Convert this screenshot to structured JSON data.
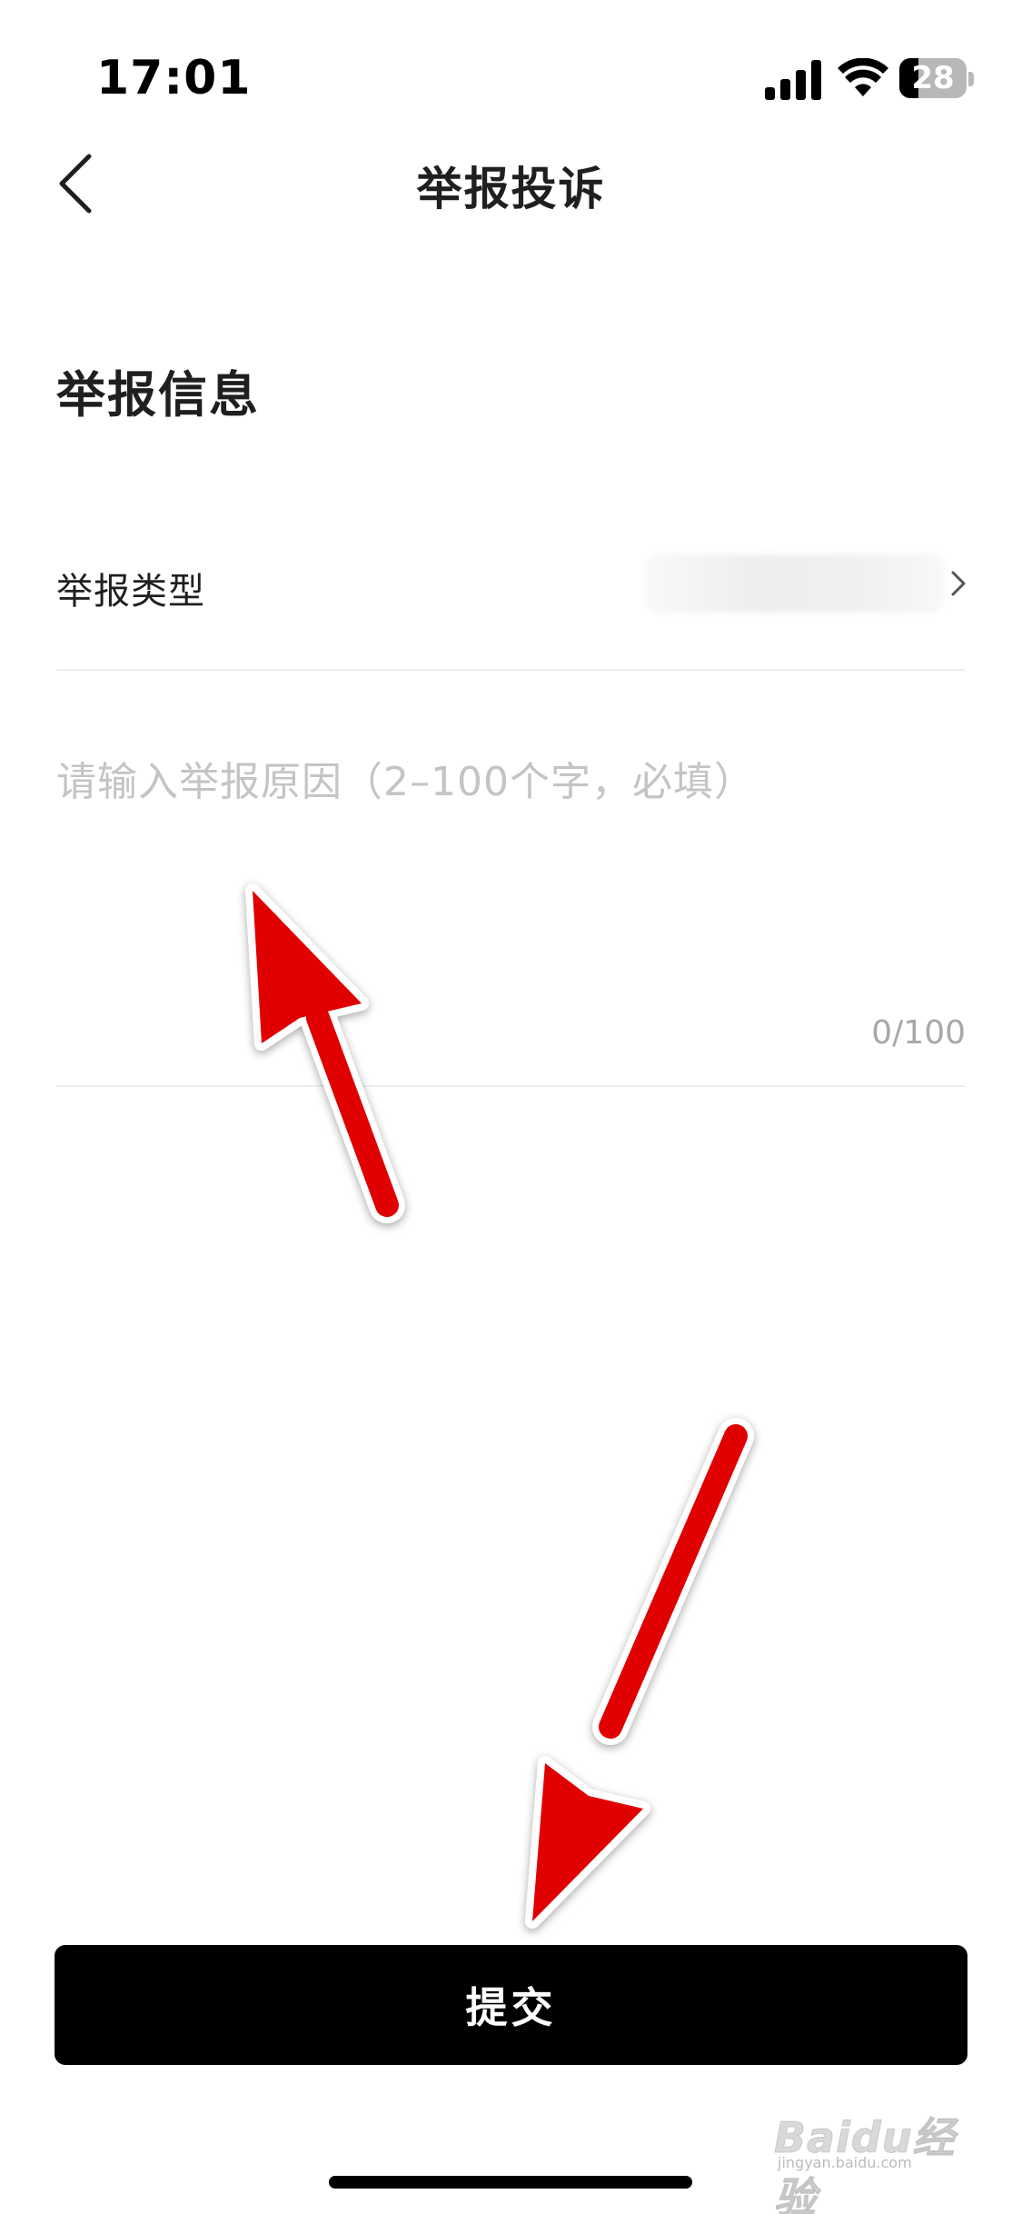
{
  "status_bar": {
    "time": "17:01",
    "battery_level": "28",
    "battery_fraction": 0.28
  },
  "nav": {
    "title": "举报投诉",
    "back_icon": "chevron-left-icon"
  },
  "section": {
    "title": "举报信息"
  },
  "report_type": {
    "label": "举报类型",
    "chevron_icon": "chevron-right-icon"
  },
  "reason": {
    "placeholder": "请输入举报原因（2–100个字，必填）",
    "counter": "0/100"
  },
  "submit": {
    "label": "提交"
  },
  "watermark": {
    "text": "Baidu经验",
    "sub": "jingyan.baidu.com"
  },
  "colors": {
    "primary_button": "#000000",
    "annotation_arrow": "#ff0000",
    "placeholder": "#c4c4c4",
    "divider": "#eeeeee"
  }
}
